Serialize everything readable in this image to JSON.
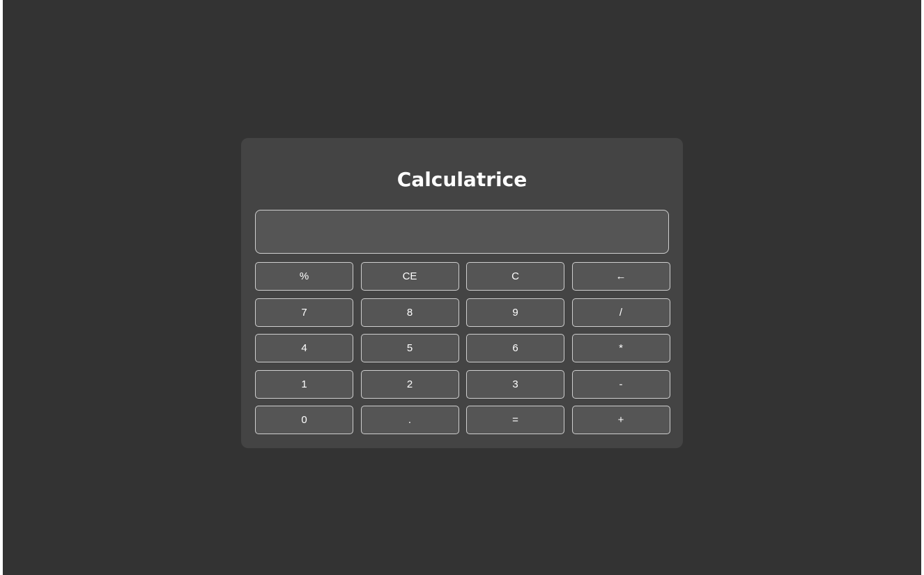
{
  "app": {
    "title": "Calculatrice"
  },
  "display": {
    "value": ""
  },
  "keys": [
    {
      "label": "%",
      "name": "percent-button"
    },
    {
      "label": "CE",
      "name": "clear-entry-button"
    },
    {
      "label": "C",
      "name": "clear-button"
    },
    {
      "label": "←",
      "name": "backspace-button"
    },
    {
      "label": "7",
      "name": "digit-7-button"
    },
    {
      "label": "8",
      "name": "digit-8-button"
    },
    {
      "label": "9",
      "name": "digit-9-button"
    },
    {
      "label": "/",
      "name": "divide-button"
    },
    {
      "label": "4",
      "name": "digit-4-button"
    },
    {
      "label": "5",
      "name": "digit-5-button"
    },
    {
      "label": "6",
      "name": "digit-6-button"
    },
    {
      "label": "*",
      "name": "multiply-button"
    },
    {
      "label": "1",
      "name": "digit-1-button"
    },
    {
      "label": "2",
      "name": "digit-2-button"
    },
    {
      "label": "3",
      "name": "digit-3-button"
    },
    {
      "label": "-",
      "name": "subtract-button"
    },
    {
      "label": "0",
      "name": "digit-0-button"
    },
    {
      "label": ".",
      "name": "decimal-point-button"
    },
    {
      "label": "=",
      "name": "equals-button"
    },
    {
      "label": "+",
      "name": "add-button"
    }
  ],
  "colors": {
    "page_background": "#333333",
    "panel_background": "#444444",
    "key_background": "#555555",
    "key_border": "#cfcfcf",
    "text": "#ffffff"
  }
}
